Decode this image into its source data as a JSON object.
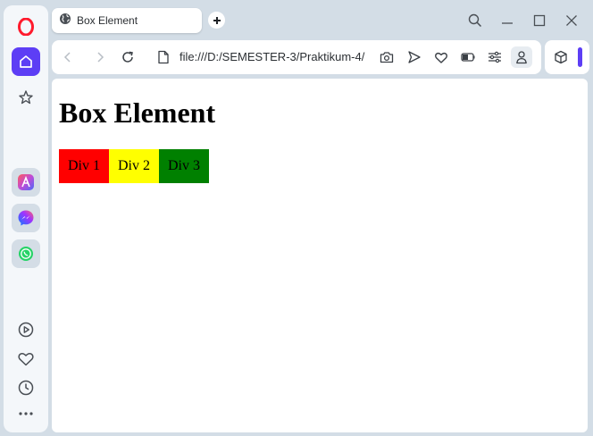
{
  "browser": {
    "tab": {
      "title": "Box Element",
      "icon": "globe-icon"
    },
    "address": {
      "url": "file:///D:/SEMESTER-3/Praktikum-4/"
    },
    "colors": {
      "accent": "#5d3ef5",
      "opera_red": "#ff1b2d"
    }
  },
  "page": {
    "heading": "Box Element",
    "boxes": [
      {
        "label": "Div 1",
        "color": "#ff0000"
      },
      {
        "label": "Div 2",
        "color": "#ffff00"
      },
      {
        "label": "Div 3",
        "color": "#008000"
      }
    ]
  }
}
